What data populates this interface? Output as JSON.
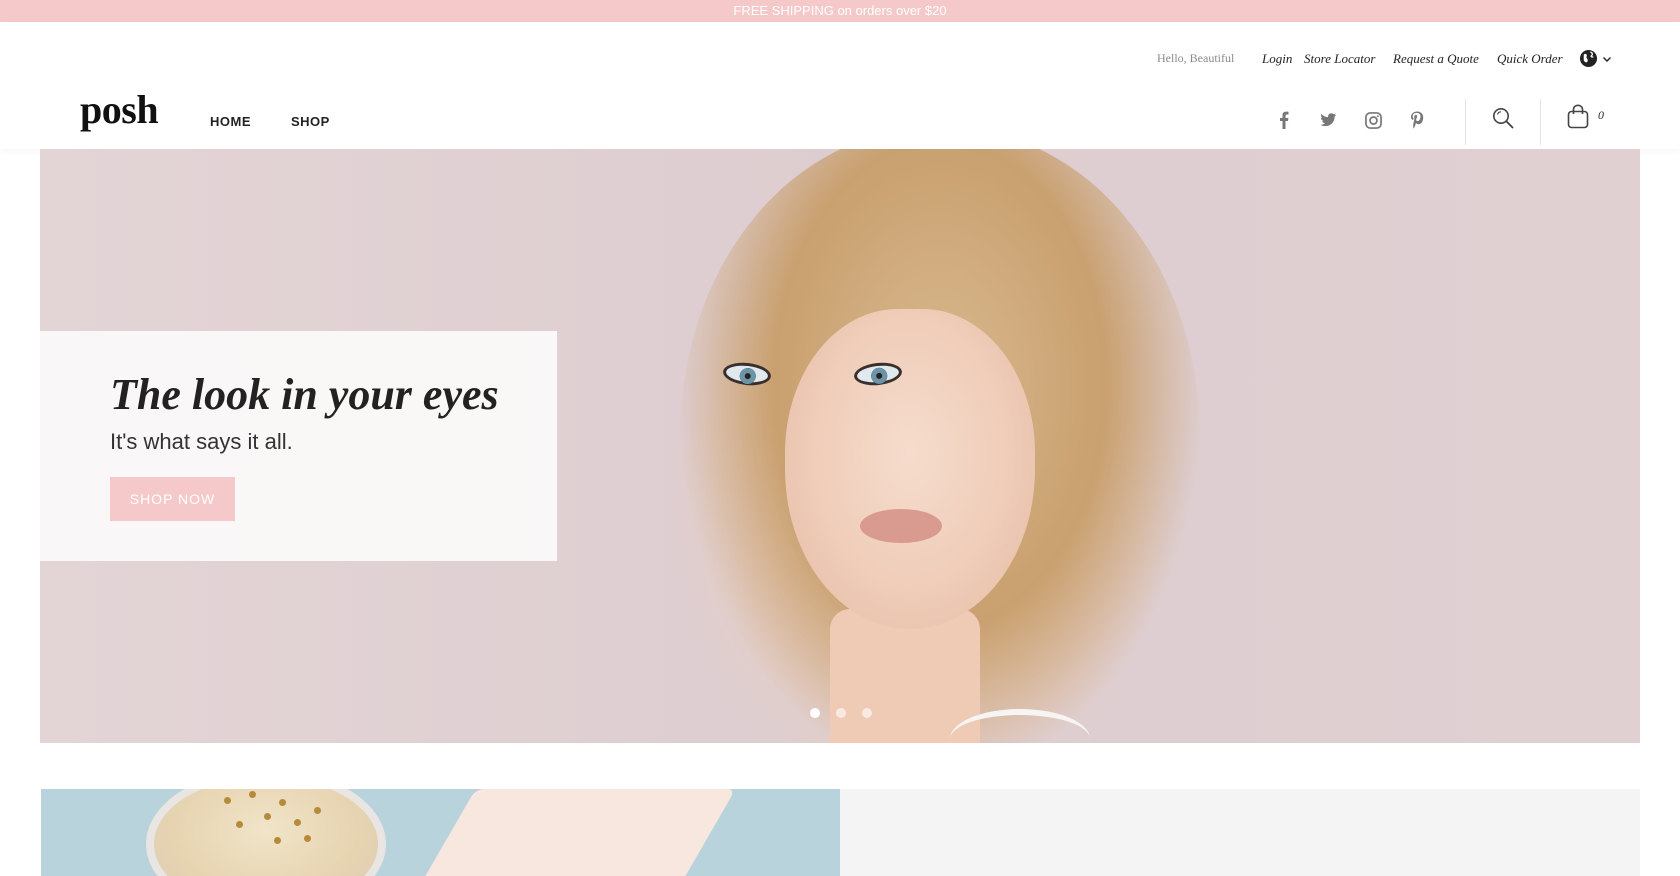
{
  "announcement": {
    "text": "FREE SHIPPING on orders over $20"
  },
  "header": {
    "greeting": "Hello, Beautiful",
    "links": {
      "login": "Login",
      "store_locator": "Store Locator",
      "request_quote": "Request a Quote",
      "quick_order": "Quick Order"
    },
    "logo": "posh",
    "nav": {
      "home": "HOME",
      "shop": "SHOP"
    },
    "cart_count": "0",
    "social_icons": [
      "facebook-icon",
      "twitter-icon",
      "instagram-icon",
      "pinterest-icon"
    ]
  },
  "hero": {
    "title": "The look in your eyes",
    "subtitle": "It's what says it all.",
    "cta": "SHOP NOW",
    "slides": 3,
    "active_slide": 1
  },
  "colors": {
    "accent_pink": "#f5c9c9",
    "text_dark": "#222222",
    "panel_gray": "#f4f4f4"
  }
}
